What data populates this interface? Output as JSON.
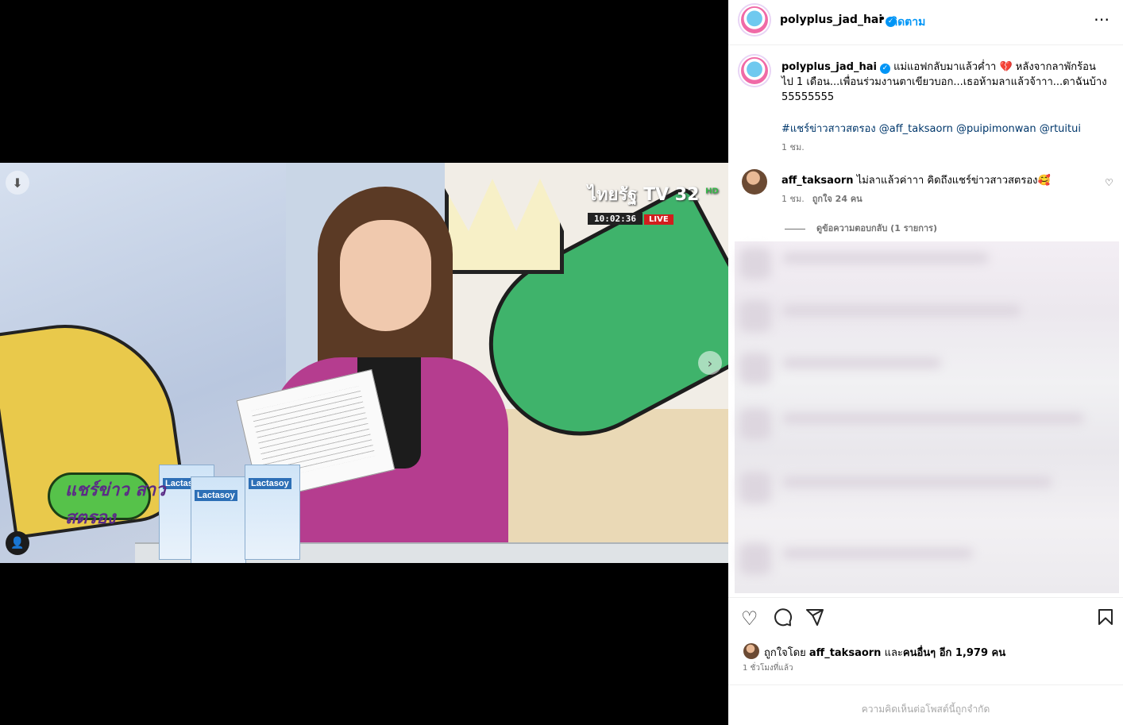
{
  "media": {
    "channel_name": "ไทยรัฐ TV 32",
    "channel_hd": "HD",
    "clock": "10:02:36",
    "live": "LIVE",
    "show_logo": "แชร์ข่าว สาวสตรอง",
    "product_brand": "Lactasoy"
  },
  "header": {
    "username": "polyplus_jad_hai",
    "separator": "•",
    "follow_label": "ติดตาม",
    "more_icon": "⋯"
  },
  "caption": {
    "username": "polyplus_jad_hai",
    "text": "แม่แอฟกลับมาแล้วค่ำา 💔 หลังจากลาพักร้อนไป 1 เดือน...เพื่อนร่วมงานตาเขียวบอก...เธอห้ามลาแล้วจ้าาา...ดาฉันบ้าง 55555555",
    "hashtags": "#แชร์ข่าวสาวสตรอง @aff_taksaorn @puipimonwan @rtuitui",
    "time": "1 ชม."
  },
  "comment": {
    "username": "aff_taksaorn",
    "text": "ไม่ลาแล้วค่าาา คิดถึงแชร์ข่าวสาวสตรอง🥰",
    "time": "1 ชม.",
    "likes": "ถูกใจ 24 คน",
    "view_replies": "ดูข้อความตอบกลับ (1 รายการ)"
  },
  "likes": {
    "prefix": "ถูกใจโดย",
    "user": "aff_taksaorn",
    "and": "และ",
    "others": "คนอื่นๆ อีก 1,979 คน"
  },
  "post_time": "1 ชั่วโมงที่แล้ว",
  "footer": {
    "comments_limited": "ความคิดเห็นต่อโพสต์นี้ถูกจำกัด"
  },
  "icons": {
    "verified": "✓",
    "download": "⬇",
    "next": "›",
    "user_tag": "👤",
    "heart": "♡",
    "comment": "💬",
    "share": "➤",
    "save": "🔖"
  },
  "colors": {
    "accent": "#0095f6",
    "link": "#00376b",
    "muted": "#737373"
  }
}
